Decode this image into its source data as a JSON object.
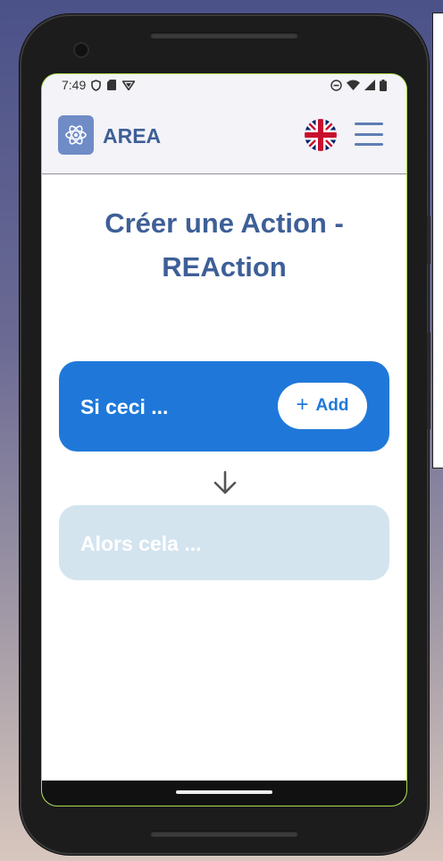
{
  "status_bar": {
    "time": "7:49",
    "left_icons": [
      "shield-icon",
      "sim-card-icon",
      "vpn-icon"
    ],
    "right_icons": [
      "do-not-disturb-icon",
      "wifi-icon",
      "signal-icon",
      "battery-icon"
    ]
  },
  "appbar": {
    "brand": "AREA",
    "logo_icon": "atom-icon",
    "language_icon": "uk-flag-icon",
    "menu_icon": "hamburger-menu-icon"
  },
  "page": {
    "title_line1": "Créer une Action -",
    "title_line2": "REAction"
  },
  "action_card": {
    "label": "Si ceci ...",
    "add_icon": "plus-icon",
    "add_label": "Add"
  },
  "connector_icon": "arrow-down-icon",
  "reaction_card": {
    "label": "Alors cela ..."
  },
  "colors": {
    "accent": "#1f78d9",
    "brand_text": "#3e5f97",
    "disabled_card": "#d3e4ef",
    "appbar_bg": "#f3f3f8"
  }
}
